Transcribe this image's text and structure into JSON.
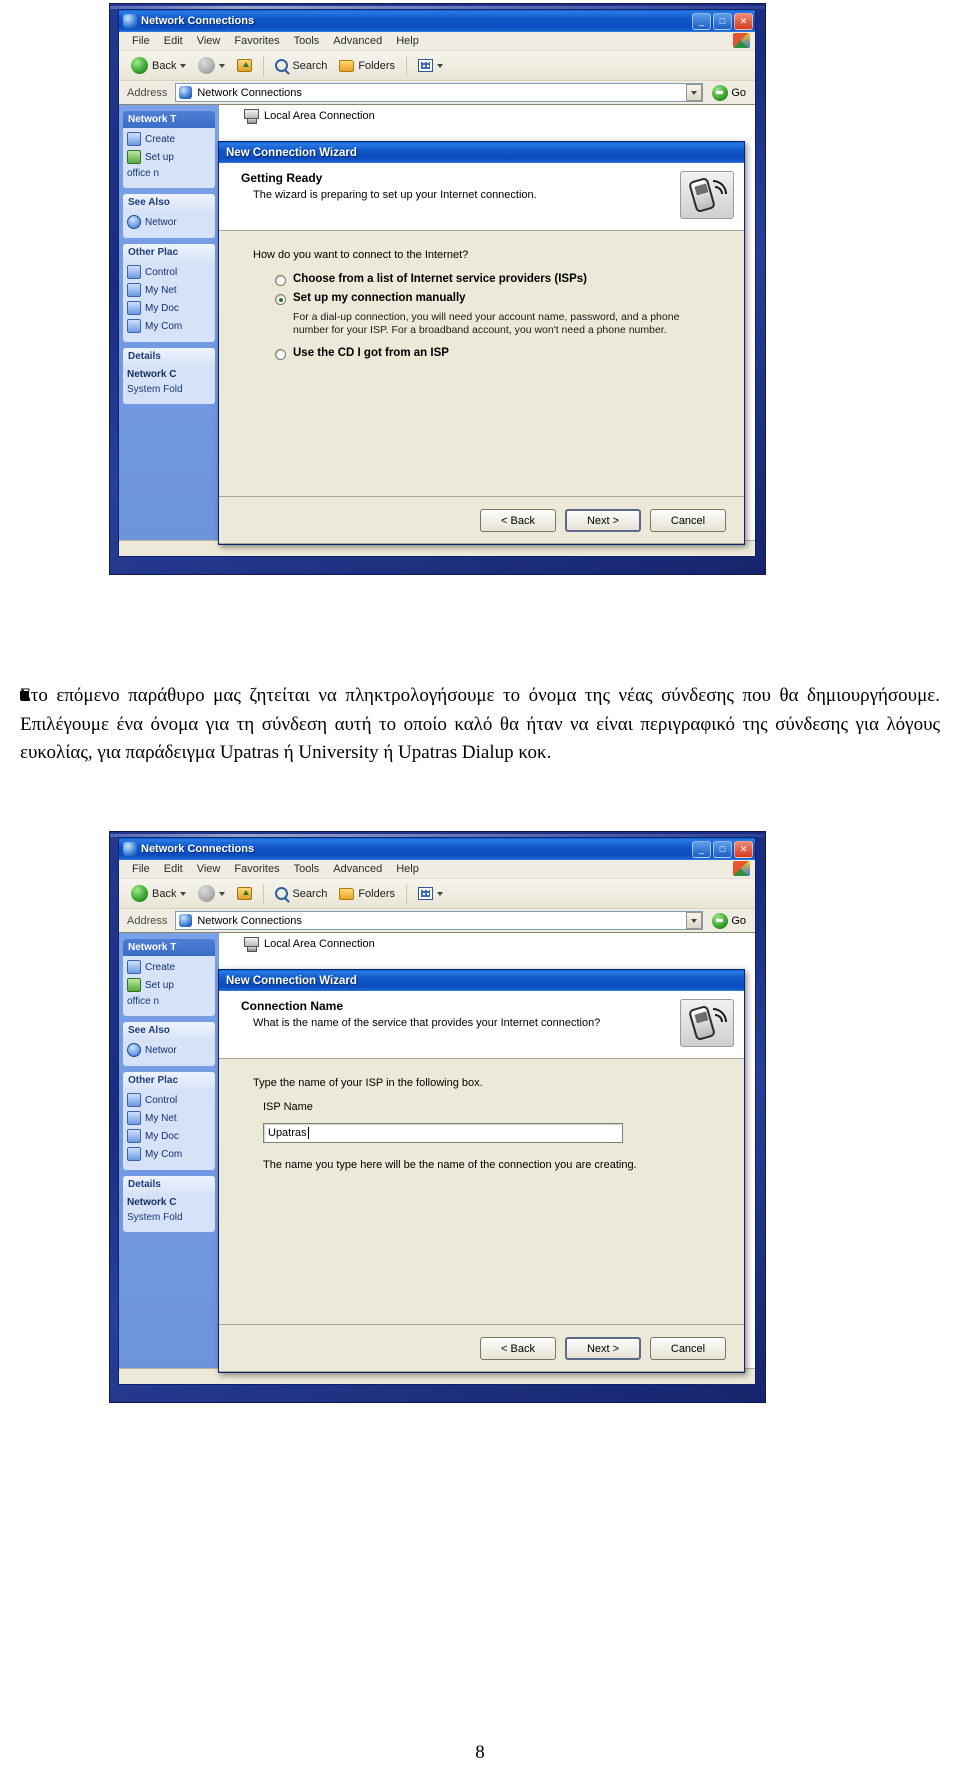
{
  "page": {
    "number": "8"
  },
  "paragraph": {
    "text": "Στο επόμενο παράθυρο μας ζητείται να πληκτρολογήσουμε το όνομα της νέας σύνδεσης που θα δημιουργήσουμε. Επιλέγουμε ένα όνομα για τη σύνδεση αυτή το οποίο καλό θα ήταν να είναι περιγραφικό της σύνδεσης για λόγους ευκολίας, για παράδειγμα Upatras ή University ή Upatras Dialup κοκ."
  },
  "explorer": {
    "title": "Network Connections",
    "title_icon": "network-globe-icon",
    "window_buttons": {
      "minimize": "_",
      "maximize": "□",
      "close": "✕"
    },
    "menu": [
      "File",
      "Edit",
      "View",
      "Favorites",
      "Tools",
      "Advanced",
      "Help"
    ],
    "toolbar": {
      "back": "Back",
      "search": "Search",
      "folders": "Folders"
    },
    "address": {
      "label": "Address",
      "value": "Network Connections",
      "go": "Go"
    },
    "taskpane": {
      "groups": [
        {
          "title": "Network T",
          "items": [
            "Create",
            "Set up",
            "office n"
          ]
        },
        {
          "title": "See Also",
          "items": [
            "Networ"
          ]
        },
        {
          "title": "Other Plac",
          "items": [
            "Control",
            "My Net",
            "My Doc",
            "My Com"
          ]
        },
        {
          "title": "Details",
          "items": [
            "Network C",
            "System Fold"
          ]
        }
      ]
    },
    "content": {
      "item": "Local Area Connection"
    }
  },
  "wizard_top": {
    "title": "New Connection Wizard",
    "heading": "Getting Ready",
    "subheading": "The wizard is preparing to set up your Internet connection.",
    "question": "How do you want to connect to the Internet?",
    "options": [
      {
        "label": "Choose from a list of Internet service providers (ISPs)",
        "selected": false,
        "description": ""
      },
      {
        "label": "Set up my connection manually",
        "selected": true,
        "description": "For a dial-up connection, you will need your account name, password, and a phone number for your ISP. For a broadband account, you won't need a phone number."
      },
      {
        "label": "Use the CD I got from an ISP",
        "selected": false,
        "description": ""
      }
    ],
    "buttons": {
      "back": "< Back",
      "next": "Next >",
      "cancel": "Cancel"
    }
  },
  "wizard_bottom": {
    "title": "New Connection Wizard",
    "heading": "Connection Name",
    "subheading": "What is the name of the service that provides your Internet connection?",
    "instruction": "Type the name of your ISP in the following box.",
    "field_label": "ISP Name",
    "field_value": "Upatras",
    "hint": "The name you type here will be the name of the connection you are creating.",
    "buttons": {
      "back": "< Back",
      "next": "Next >",
      "cancel": "Cancel"
    }
  }
}
